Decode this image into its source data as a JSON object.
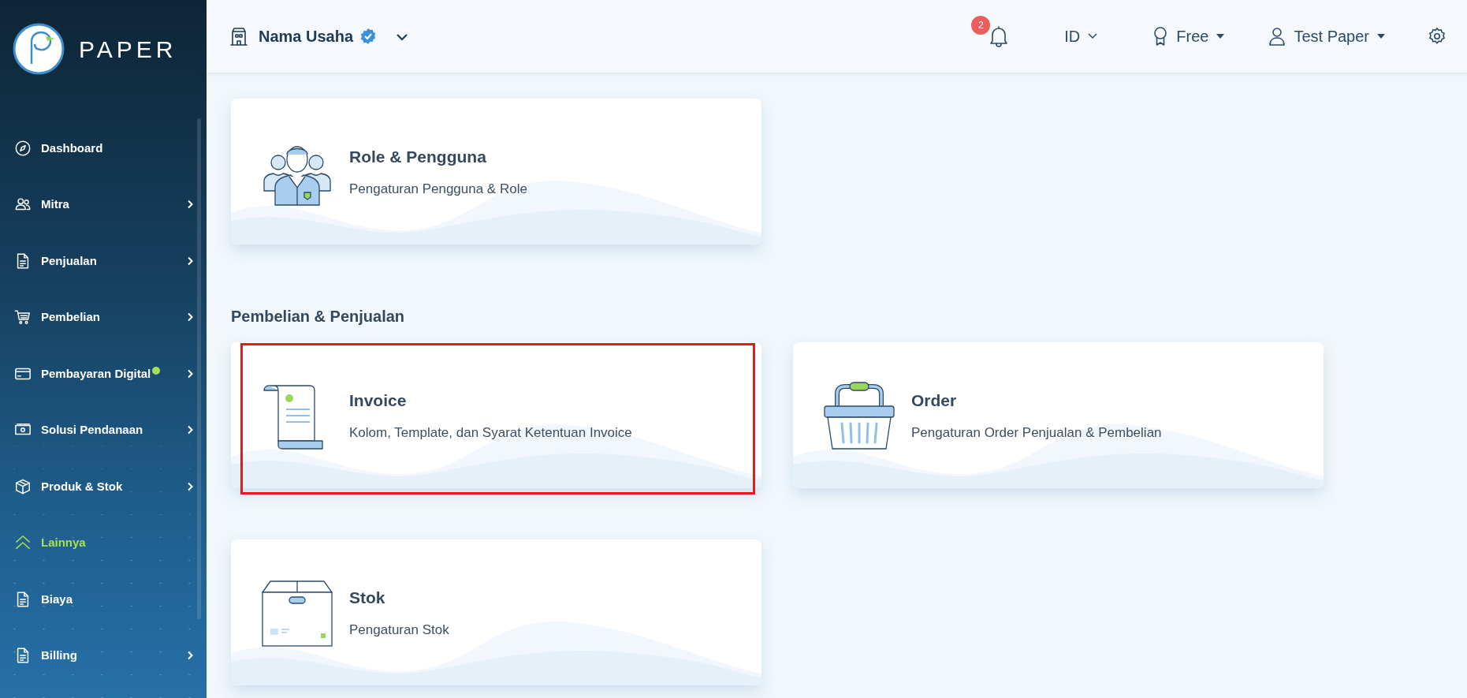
{
  "brand": {
    "name": "PAPER"
  },
  "sidebar": {
    "items": [
      {
        "label": "Dashboard",
        "chevron": false,
        "dot": false,
        "selected": false
      },
      {
        "label": "Mitra",
        "chevron": true,
        "dot": false,
        "selected": false
      },
      {
        "label": "Penjualan",
        "chevron": true,
        "dot": false,
        "selected": false
      },
      {
        "label": "Pembelian",
        "chevron": true,
        "dot": false,
        "selected": false
      },
      {
        "label": "Pembayaran Digital",
        "chevron": true,
        "dot": true,
        "selected": false
      },
      {
        "label": "Solusi Pendanaan",
        "chevron": true,
        "dot": false,
        "selected": false
      },
      {
        "label": "Produk & Stok",
        "chevron": true,
        "dot": false,
        "selected": false
      },
      {
        "label": "Lainnya",
        "chevron": false,
        "dot": false,
        "selected": true
      },
      {
        "label": "Biaya",
        "chevron": false,
        "dot": false,
        "selected": false
      },
      {
        "label": "Billing",
        "chevron": true,
        "dot": false,
        "selected": false
      }
    ]
  },
  "header": {
    "business": "Nama Usaha",
    "verified": true,
    "notifications": "2",
    "language": "ID",
    "plan": "Free",
    "user": "Test Paper"
  },
  "sections": [
    {
      "cards": [
        {
          "kind": "people",
          "title": "Role & Pengguna",
          "description": "Pengaturan Pengguna & Role",
          "highlighted": false
        }
      ]
    },
    {
      "heading": "Pembelian & Penjualan",
      "cards": [
        {
          "kind": "scroll",
          "title": "Invoice",
          "description": "Kolom, Template, dan Syarat Ketentuan Invoice",
          "highlighted": true
        },
        {
          "kind": "basket",
          "title": "Order",
          "description": "Pengaturan Order Penjualan & Pembelian",
          "highlighted": false
        }
      ]
    },
    {
      "cards": [
        {
          "kind": "box",
          "title": "Stok",
          "description": "Pengaturan Stok",
          "highlighted": false
        }
      ]
    }
  ]
}
